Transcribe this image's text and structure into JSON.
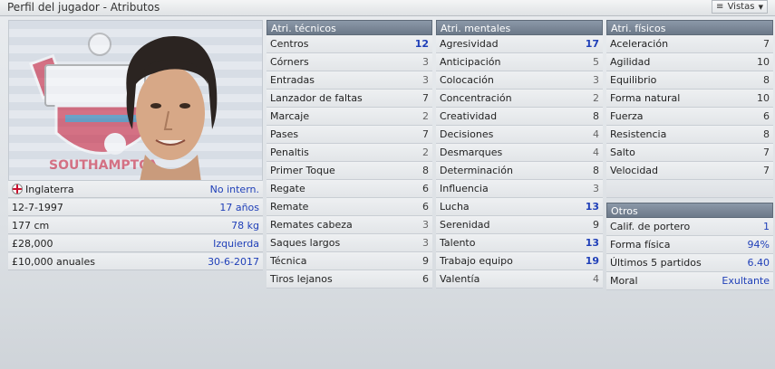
{
  "window": {
    "title": "Perfil del jugador - Atributos",
    "views_label": "Vistas"
  },
  "player": {
    "nationality": "Inglaterra",
    "international": "No intern.",
    "birth_date": "12-7-1997",
    "age": "17 años",
    "height": "177 cm",
    "weight": "78 kg",
    "value": "£28,000",
    "foot": "Izquierda",
    "wage": "£10,000 anuales",
    "contract_end": "30-6-2017"
  },
  "technical": {
    "header": "Atri. técnicos",
    "items": [
      {
        "name": "Centros",
        "value": "12"
      },
      {
        "name": "Córners",
        "value": "3"
      },
      {
        "name": "Entradas",
        "value": "3"
      },
      {
        "name": "Lanzador de faltas",
        "value": "7"
      },
      {
        "name": "Marcaje",
        "value": "2"
      },
      {
        "name": "Pases",
        "value": "7"
      },
      {
        "name": "Penaltis",
        "value": "2"
      },
      {
        "name": "Primer Toque",
        "value": "8"
      },
      {
        "name": "Regate",
        "value": "6"
      },
      {
        "name": "Remate",
        "value": "6"
      },
      {
        "name": "Remates cabeza",
        "value": "3"
      },
      {
        "name": "Saques largos",
        "value": "3"
      },
      {
        "name": "Técnica",
        "value": "9"
      },
      {
        "name": "Tiros lejanos",
        "value": "6"
      }
    ]
  },
  "mental": {
    "header": "Atri. mentales",
    "items": [
      {
        "name": "Agresividad",
        "value": "17"
      },
      {
        "name": "Anticipación",
        "value": "5"
      },
      {
        "name": "Colocación",
        "value": "3"
      },
      {
        "name": "Concentración",
        "value": "2"
      },
      {
        "name": "Creatividad",
        "value": "8"
      },
      {
        "name": "Decisiones",
        "value": "4"
      },
      {
        "name": "Desmarques",
        "value": "4"
      },
      {
        "name": "Determinación",
        "value": "8"
      },
      {
        "name": "Influencia",
        "value": "3"
      },
      {
        "name": "Lucha",
        "value": "13"
      },
      {
        "name": "Serenidad",
        "value": "9"
      },
      {
        "name": "Talento",
        "value": "13"
      },
      {
        "name": "Trabajo equipo",
        "value": "19"
      },
      {
        "name": "Valentía",
        "value": "4"
      }
    ]
  },
  "physical": {
    "header": "Atri. físicos",
    "items": [
      {
        "name": "Aceleración",
        "value": "7"
      },
      {
        "name": "Agilidad",
        "value": "10"
      },
      {
        "name": "Equilibrio",
        "value": "8"
      },
      {
        "name": "Forma natural",
        "value": "10"
      },
      {
        "name": "Fuerza",
        "value": "6"
      },
      {
        "name": "Resistencia",
        "value": "8"
      },
      {
        "name": "Salto",
        "value": "7"
      },
      {
        "name": "Velocidad",
        "value": "7"
      }
    ]
  },
  "others": {
    "header": "Otros",
    "items": [
      {
        "name": "Calif. de portero",
        "value": "1"
      },
      {
        "name": "Forma física",
        "value": "94%"
      },
      {
        "name": "Últimos 5 partidos",
        "value": "6.40"
      },
      {
        "name": "Moral",
        "value": "Exultante"
      }
    ]
  },
  "crest_text": "SOUTHAMPTON",
  "colors": {
    "accent_blue": "#1f3fb8",
    "header_bg": "#7b8898",
    "flag_red": "#c8102e"
  }
}
